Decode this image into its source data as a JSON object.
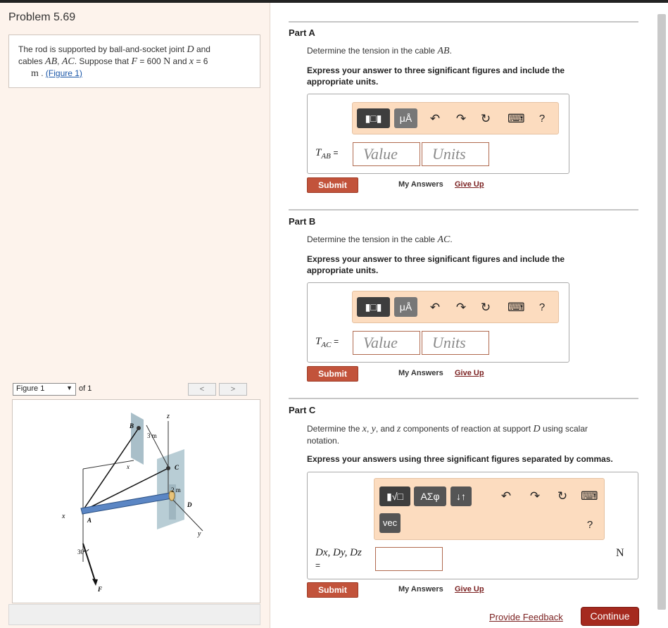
{
  "problem": {
    "title": "Problem 5.69",
    "statement": {
      "line1": "The rod is supported by ball-and-socket joint",
      "D": "D",
      "and": "and",
      "cables_pre": "cables",
      "AB": "AB",
      "AC": "AC",
      "suppose": ". Suppose that",
      "F": "F",
      "F_eq": "= 600",
      "unitN": "N",
      "and_x": "and",
      "x": "x",
      "x_eq": "= 6",
      "unit_m": "m",
      "figure_link": "(Figure 1)"
    }
  },
  "figure": {
    "select_label": "Figure 1",
    "of_label": "of 1",
    "prev": "<",
    "next": ">",
    "labels": {
      "z": "z",
      "B": "B",
      "three_m": "3 m",
      "x_top": "x",
      "C": "C",
      "two_m": "2 m",
      "D": "D",
      "x_left": "x",
      "A": "A",
      "y": "y",
      "angle": "30°",
      "F": "F"
    }
  },
  "partA": {
    "title": "Part A",
    "question_pre": "Determine the tension in the cable",
    "question_var": "AB",
    "question_post": ".",
    "instruction": "Express your answer to three significant figures and include the appropriate units.",
    "var_main": "T",
    "var_sub": "AB",
    "eq": "=",
    "value_placeholder": "Value",
    "units_placeholder": "Units",
    "submit": "Submit",
    "my_answers": "My Answers",
    "give_up": "Give Up"
  },
  "partB": {
    "title": "Part B",
    "question_pre": "Determine the tension in the cable",
    "question_var": "AC",
    "question_post": ".",
    "instruction": "Express your answer to three significant figures and include the appropriate units.",
    "var_main": "T",
    "var_sub": "AC",
    "eq": "=",
    "value_placeholder": "Value",
    "units_placeholder": "Units",
    "submit": "Submit",
    "my_answers": "My Answers",
    "give_up": "Give Up"
  },
  "partC": {
    "title": "Part C",
    "question_pre": "Determine the",
    "x": "x",
    "c1": ",",
    "y": "y",
    "c2": ", and",
    "z": "z",
    "question_mid": "components of reaction at support",
    "D": "D",
    "question_post": "using scalar",
    "question_line2": "notation.",
    "instruction": "Express your answers using three significant figures separated by commas.",
    "var_label": "Dx, Dy, Dz",
    "eq": "=",
    "unit": "N",
    "submit": "Submit",
    "my_answers": "My Answers",
    "give_up": "Give Up"
  },
  "toolbar": {
    "templates_icon": "▮□▮",
    "units_btn": "μÅ",
    "undo": "↶",
    "redo": "↷",
    "reset": "↻",
    "keyboard": "⌨",
    "help": "?",
    "sqrt_btn": "▮√□",
    "greek_btn": "ΑΣφ",
    "arrows_btn": "↓↑",
    "vec_btn": "vec"
  },
  "footer": {
    "feedback": "Provide Feedback",
    "continue": "Continue"
  }
}
